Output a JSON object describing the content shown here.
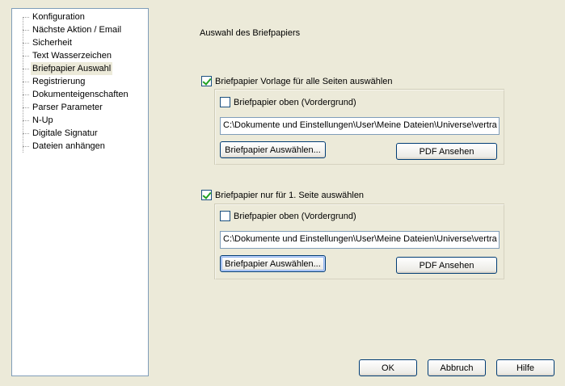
{
  "tree": {
    "items": [
      {
        "label": "Konfiguration"
      },
      {
        "label": "Nächste Aktion / Email"
      },
      {
        "label": "Sicherheit"
      },
      {
        "label": "Text Wasserzeichen"
      },
      {
        "label": "Briefpapier Auswahl",
        "selected": true
      },
      {
        "label": "Registrierung"
      },
      {
        "label": "Dokumenteigenschaften"
      },
      {
        "label": "Parser Parameter"
      },
      {
        "label": "N-Up"
      },
      {
        "label": "Digitale Signatur"
      },
      {
        "label": "Dateien anhängen"
      }
    ]
  },
  "main": {
    "heading": "Auswahl des Briefpapiers",
    "all_pages": {
      "checkbox_label": "Briefpapier Vorlage für alle Seiten auswählen",
      "checked": true,
      "foreground_label": "Briefpapier oben (Vordergrund)",
      "foreground_checked": false,
      "path": "C:\\Dokumente und Einstellungen\\User\\Meine Dateien\\Universe\\vertra",
      "select_button": "Briefpapier Auswählen...",
      "view_button": "PDF Ansehen"
    },
    "first_page": {
      "checkbox_label": "Briefpapier nur für 1. Seite auswählen",
      "checked": true,
      "foreground_label": "Briefpapier oben (Vordergrund)",
      "foreground_checked": false,
      "path": "C:\\Dokumente und Einstellungen\\User\\Meine Dateien\\Universe\\vertra",
      "select_button": "Briefpapier Auswählen...",
      "view_button": "PDF Ansehen"
    }
  },
  "footer": {
    "ok": "OK",
    "cancel": "Abbruch",
    "help": "Hilfe"
  },
  "colors": {
    "dialog_bg": "#ecead9",
    "checkmark": "#21a121",
    "field_border": "#7f9db9",
    "button_border": "#003c74"
  }
}
